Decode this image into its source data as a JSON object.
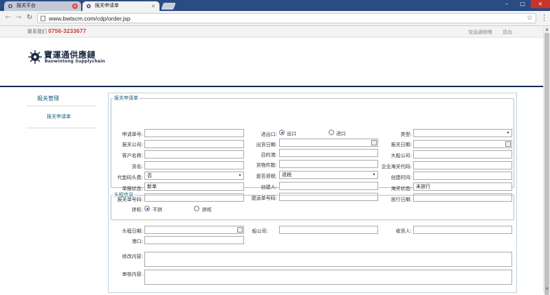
{
  "browser": {
    "tabs": [
      {
        "label": "报关平台",
        "active": false
      },
      {
        "label": "报关申请单",
        "active": true
      }
    ],
    "url": "www.bwtscm.com/cdp/order.jsp"
  },
  "topbar": {
    "contact_label": "联系我们",
    "phone": "0756-3233677",
    "links": [
      "宝运通物理",
      "退出"
    ]
  },
  "logo": {
    "cn": "寶運通供應鏈",
    "en": "Baowintong Supplychain"
  },
  "sidenav": {
    "header": "报关管理",
    "items": [
      "报关申请单"
    ]
  },
  "form": {
    "section1_title": "报关申请单",
    "section2_title": "头程信息",
    "fields": {
      "order_no": {
        "label": "申请单号:",
        "value": ""
      },
      "direction": {
        "label": "进出口:",
        "options": [
          "出口",
          "进口"
        ],
        "selected": "出口"
      },
      "type": {
        "label": "类型:",
        "value": ""
      },
      "customs_company": {
        "label": "报关公司:",
        "value": ""
      },
      "ship_date": {
        "label": "出货日期:",
        "value": ""
      },
      "customs_date": {
        "label": "报关日期:",
        "value": ""
      },
      "customer_name": {
        "label": "客户名称:",
        "value": ""
      },
      "destination_port": {
        "label": "目的港:",
        "value": ""
      },
      "vessel_company": {
        "label": "大船公司:",
        "value": ""
      },
      "goods_name": {
        "label": "货名:",
        "value": ""
      },
      "goods_pieces": {
        "label": "货物件数:",
        "value": ""
      },
      "enterprise_code": {
        "label": "企业海关代码:",
        "value": ""
      },
      "agent_header": {
        "label": "代垫码头费:",
        "value": "否"
      },
      "tax_refund": {
        "label": "是否退税:",
        "value": "退税"
      },
      "created_time": {
        "label": "创建时间:",
        "value": ""
      },
      "doc_status": {
        "label": "单据状态:",
        "value": "新单"
      },
      "creator": {
        "label": "创建人:",
        "value": ""
      },
      "customs_status": {
        "label": "海关状态:",
        "value": "未放行"
      },
      "declaration_no": {
        "label": "报关单号码:",
        "value": ""
      },
      "bl_no": {
        "label": "提运单号码:",
        "value": ""
      },
      "release_date": {
        "label": "放行日期:",
        "value": ""
      },
      "consolidate": {
        "label": "拼柜:",
        "options": [
          "不拼",
          "拼柜"
        ],
        "selected": "不拼"
      },
      "first_leg_date": {
        "label": "头程日期:",
        "value": ""
      },
      "ship_company": {
        "label": "船公司:",
        "value": ""
      },
      "consignee": {
        "label": "收货人:",
        "value": ""
      },
      "port": {
        "label": "港口:",
        "value": ""
      },
      "modify_content": {
        "label": "修改内容:",
        "value": ""
      },
      "review_content": {
        "label": "审核内容:",
        "value": ""
      }
    }
  }
}
